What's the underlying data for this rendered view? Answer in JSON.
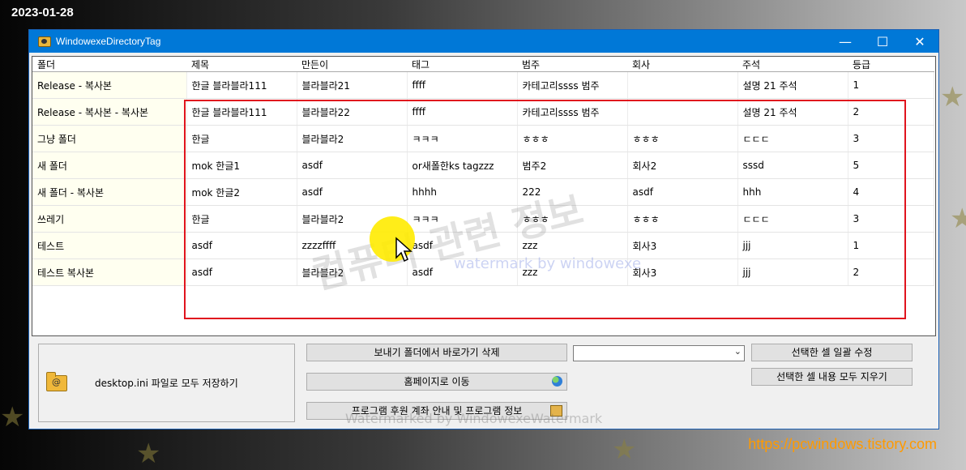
{
  "date_stamp": "2023-01-28",
  "site_url": "https://pcwindows.tistory.com",
  "window": {
    "title": "WindowexeDirectoryTag",
    "minimize": "—",
    "maximize": "☐",
    "close": "✕"
  },
  "grid": {
    "columns": [
      "폴더",
      "제목",
      "만든이",
      "태그",
      "범주",
      "회사",
      "주석",
      "등급"
    ],
    "rows": [
      [
        "Release - 복사본",
        "한글 블라블라111",
        "블라블라21",
        "ffff",
        "카테고리ssss 범주",
        "",
        "설명 21 주석",
        "1"
      ],
      [
        "Release - 복사본 - 복사본",
        "한글 블라블라111",
        "블라블라22",
        "ffff",
        "카테고리ssss 범주",
        "",
        "설명 21 주석",
        "2"
      ],
      [
        "그냥 폴더",
        "한글",
        "블라블라2",
        "ㅋㅋㅋ",
        "ㅎㅎㅎ",
        "ㅎㅎㅎ",
        "ㄷㄷㄷ",
        "3"
      ],
      [
        "새 폴더",
        "mok 한글1",
        "asdf",
        "or새폴한ks tagzzz",
        "범주2",
        "회사2",
        "sssd",
        "5"
      ],
      [
        "새 폴더 - 복사본",
        "mok 한글2",
        "asdf",
        "hhhh",
        "222",
        "asdf",
        "hhh",
        "4"
      ],
      [
        "쓰레기",
        "한글",
        "블라블라2",
        "ㅋㅋㅋ",
        "ㅎㅎㅎ",
        "ㅎㅎㅎ",
        "ㄷㄷㄷ",
        "3"
      ],
      [
        "테스트",
        "asdf",
        "zzzzffff",
        "asdf",
        "zzz",
        "회사3",
        "jjj",
        "1"
      ],
      [
        "테스트 복사본",
        "asdf",
        "블라블라2",
        "asdf",
        "zzz",
        "회사3",
        "jjj",
        "2"
      ]
    ]
  },
  "buttons": {
    "save_all": "desktop.ini 파일로 모두 저장하기",
    "delete_shortcut": "보내기 폴더에서 바로가기 삭제",
    "homepage": "홈페이지로 이동",
    "donation_info": "프로그램 후원 계좌 안내 및 프로그램 정보",
    "bulk_edit": "선택한 셀 일괄 수정",
    "clear_cells": "선택한 셀 내용 모두 지우기"
  },
  "dropdown": {
    "selected": ""
  },
  "watermarks": {
    "korean": "컴퓨터 관련 정보",
    "english": "watermark by windowexe",
    "bottom": "Watermarked by WindowexeWatermark"
  },
  "icons": {
    "app": "folder-tag-icon",
    "save": "folder-icon",
    "homepage": "globe-icon",
    "donation": "gift-icon",
    "dropdown": "chevron-down-icon"
  }
}
